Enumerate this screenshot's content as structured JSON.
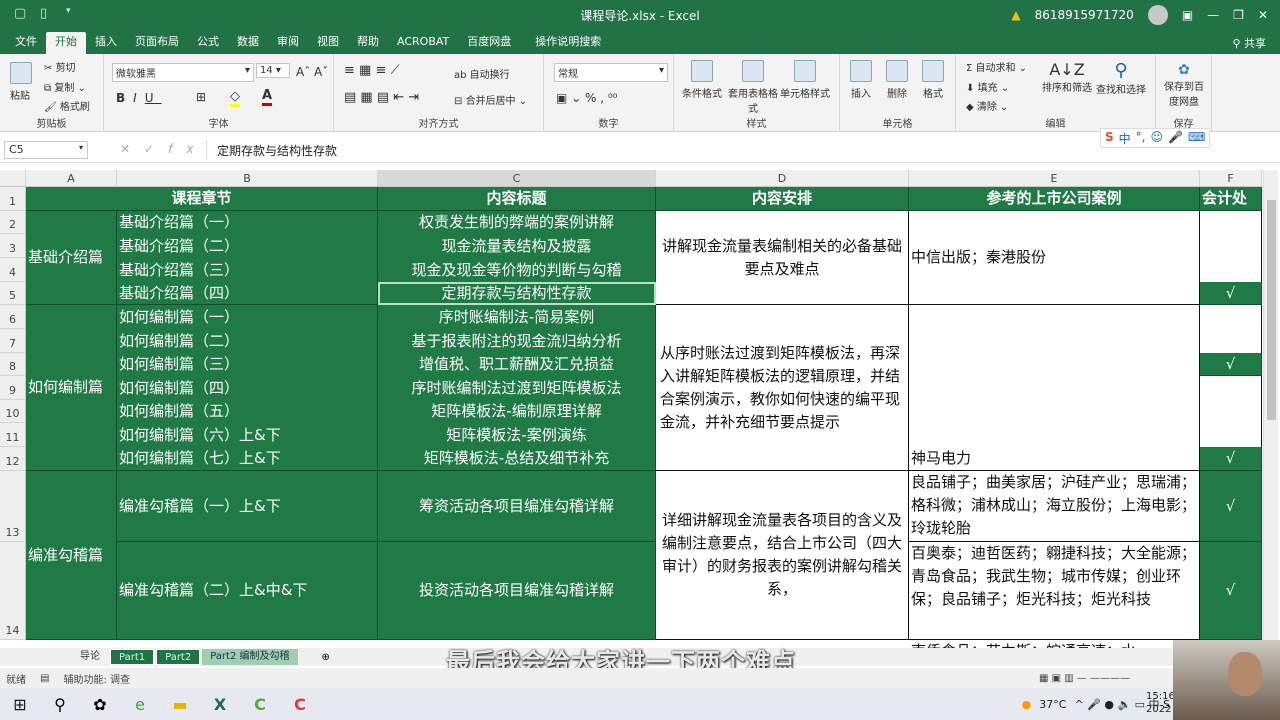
{
  "window": {
    "title": "课程导论.xlsx - Excel",
    "account": "8618915971720",
    "share": "共享"
  },
  "ribbon_tabs": [
    "文件",
    "开始",
    "插入",
    "页面布局",
    "公式",
    "数据",
    "审阅",
    "视图",
    "帮助",
    "ACROBAT",
    "百度网盘",
    "操作说明搜索"
  ],
  "ribbon": {
    "clipboard": {
      "paste": "粘贴",
      "cut": "剪切",
      "copy": "复制",
      "painter": "格式刷",
      "label": "剪贴板"
    },
    "font": {
      "name": "微软雅黑",
      "size": "14",
      "label": "字体"
    },
    "align": {
      "wrap": "自动换行",
      "merge": "合并后居中",
      "label": "对齐方式"
    },
    "number": {
      "format": "常规",
      "label": "数字"
    },
    "styles": {
      "cond": "条件格式",
      "table": "套用表格格式",
      "cell": "单元格样式",
      "label": "样式"
    },
    "cells": {
      "insert": "插入",
      "delete": "删除",
      "format": "格式",
      "label": "单元格"
    },
    "editing": {
      "autosum": "自动求和",
      "fill": "填充",
      "clear": "清除",
      "sort": "排序和筛选",
      "find": "查找和选择",
      "label": "编辑"
    },
    "save": {
      "baidu": "保存到百度网盘",
      "label": "保存"
    }
  },
  "formula_bar": {
    "name_box": "C5",
    "formula": "定期存款与结构性存款"
  },
  "columns": [
    "A",
    "B",
    "C",
    "D",
    "E",
    "F"
  ],
  "rows": [
    "1",
    "2",
    "3",
    "4",
    "5",
    "6",
    "7",
    "8",
    "9",
    "10",
    "11",
    "12",
    "13",
    "14"
  ],
  "cells": [
    {
      "col": "A",
      "row": 1,
      "span_cols": 2,
      "text": "课程章节",
      "style": "g h"
    },
    {
      "col": "C",
      "row": 1,
      "text": "内容标题",
      "style": "g h"
    },
    {
      "col": "D",
      "row": 1,
      "text": "内容安排",
      "style": "g h"
    },
    {
      "col": "E",
      "row": 1,
      "text": "参考的上市公司案例",
      "style": "g h"
    },
    {
      "col": "F",
      "row": 1,
      "text": "会计处",
      "style": "g h l"
    },
    {
      "col": "A",
      "row": 2,
      "span_rows": 4,
      "text": "基础介绍篇",
      "style": "g l"
    },
    {
      "col": "B",
      "row": 2,
      "text": "基础介绍篇（一）",
      "style": "g l nob"
    },
    {
      "col": "B",
      "row": 3,
      "text": "基础介绍篇（二）",
      "style": "g l nob"
    },
    {
      "col": "B",
      "row": 4,
      "text": "基础介绍篇（三）",
      "style": "g l nob"
    },
    {
      "col": "B",
      "row": 5,
      "text": "基础介绍篇（四）",
      "style": "g l"
    },
    {
      "col": "C",
      "row": 2,
      "text": "权责发生制的弊端的案例讲解",
      "style": "g c nob"
    },
    {
      "col": "C",
      "row": 3,
      "text": "现金流量表结构及披露",
      "style": "g c nob"
    },
    {
      "col": "C",
      "row": 4,
      "text": "现金及现金等价物的判断与勾稽",
      "style": "g c nob"
    },
    {
      "col": "C",
      "row": 5,
      "text": "定期存款与结构性存款",
      "style": "g c"
    },
    {
      "col": "D",
      "row": 2,
      "span_rows": 4,
      "text": "讲解现金流量表编制相关的必备基础要点及难点",
      "style": "w c"
    },
    {
      "col": "E",
      "row": 2,
      "span_rows": 4,
      "text": "中信出版；秦港股份",
      "style": "w l"
    },
    {
      "col": "F",
      "row": 2,
      "span_rows": 3,
      "text": "",
      "style": "w nob"
    },
    {
      "col": "F",
      "row": 5,
      "text": "√",
      "style": "g c"
    },
    {
      "col": "A",
      "row": 6,
      "span_rows": 7,
      "text": "如何编制篇",
      "style": "g l"
    },
    {
      "col": "B",
      "row": 6,
      "text": "如何编制篇（一）",
      "style": "g l nob"
    },
    {
      "col": "B",
      "row": 7,
      "text": "如何编制篇（二）",
      "style": "g l nob"
    },
    {
      "col": "B",
      "row": 8,
      "text": "如何编制篇（三）",
      "style": "g l nob"
    },
    {
      "col": "B",
      "row": 9,
      "text": "如何编制篇（四）",
      "style": "g l nob"
    },
    {
      "col": "B",
      "row": 10,
      "text": "如何编制篇（五）",
      "style": "g l nob"
    },
    {
      "col": "B",
      "row": 11,
      "text": "如何编制篇（六）上&下",
      "style": "g l nob"
    },
    {
      "col": "B",
      "row": 12,
      "text": "如何编制篇（七）上&下",
      "style": "g l"
    },
    {
      "col": "C",
      "row": 6,
      "text": "序时账编制法-简易案例",
      "style": "g c nob"
    },
    {
      "col": "C",
      "row": 7,
      "text": "基于报表附注的现金流归纳分析",
      "style": "g c nob"
    },
    {
      "col": "C",
      "row": 8,
      "text": "增值税、职工薪酬及汇兑损益",
      "style": "g c nob"
    },
    {
      "col": "C",
      "row": 9,
      "text": "序时账编制法过渡到矩阵模板法",
      "style": "g c nob"
    },
    {
      "col": "C",
      "row": 10,
      "text": "矩阵模板法-编制原理详解",
      "style": "g c nob"
    },
    {
      "col": "C",
      "row": 11,
      "text": "矩阵模板法-案例演练",
      "style": "g c nob"
    },
    {
      "col": "C",
      "row": 12,
      "text": "矩阵模板法-总结及细节补充",
      "style": "g c"
    },
    {
      "col": "D",
      "row": 6,
      "span_rows": 7,
      "text": "从序时账法过渡到矩阵模板法，再深入讲解矩阵模板法的逻辑原理，并结合案例演示，教你如何快速的编平现金流，并补充细节要点提示",
      "style": "w l"
    },
    {
      "col": "E",
      "row": 6,
      "span_rows": 7,
      "text": "神马电力",
      "style": "w l bot"
    },
    {
      "col": "F",
      "row": 6,
      "span_rows": 2,
      "text": "",
      "style": "w nob"
    },
    {
      "col": "F",
      "row": 8,
      "text": "√",
      "style": "g c"
    },
    {
      "col": "F",
      "row": 9,
      "span_rows": 3,
      "text": "",
      "style": "w nob"
    },
    {
      "col": "F",
      "row": 12,
      "text": "√",
      "style": "g c"
    },
    {
      "col": "A",
      "row": 13,
      "span_rows": 2,
      "text": "编准勾稽篇",
      "style": "g l"
    },
    {
      "col": "B",
      "row": 13,
      "text": "编准勾稽篇（一）上&下",
      "style": "g l"
    },
    {
      "col": "B",
      "row": 14,
      "text": "编准勾稽篇（二）上&中&下",
      "style": "g l"
    },
    {
      "col": "C",
      "row": 13,
      "text": "筹资活动各项目编准勾稽详解",
      "style": "g c"
    },
    {
      "col": "C",
      "row": 14,
      "text": "投资活动各项目编准勾稽详解",
      "style": "g c"
    },
    {
      "col": "D",
      "row": 13,
      "span_rows": 2,
      "text": "详细讲解现金流量表各项目的含义及编制注意要点，结合上市公司（四大审计）的财务报表的案例讲解勾稽关系，",
      "style": "w c"
    },
    {
      "col": "E",
      "row": 13,
      "text": "良品铺子；曲美家居；沪硅产业；思瑞浦；格科微；浦林成山；海立股份；上海电影；玲珑轮胎",
      "style": "w l top"
    },
    {
      "col": "E",
      "row": 14,
      "text": "百奥泰；迪哲医药；翱捷科技；大全能源；青岛食品；我武生物；城市传媒；创业环保；良品铺子；炬光科技；炬光科技",
      "style": "w l top"
    },
    {
      "col": "E",
      "row": 15,
      "text": "南侨食品；艾力斯；皖通高速；水",
      "style": "w l top"
    },
    {
      "col": "F",
      "row": 13,
      "text": "√",
      "style": "g c"
    },
    {
      "col": "F",
      "row": 14,
      "text": "√",
      "style": "g c"
    }
  ],
  "sheet_tabs": [
    "导论",
    "Part1",
    "Part2",
    "Part2 编制及勾稽"
  ],
  "active_sheet": "Part2 编制及勾稽",
  "status": {
    "ready": "就绪",
    "accessibility": "辅助功能: 调查"
  },
  "subtitle": "最后我会给大家讲一下两个难点",
  "taskbar": {
    "weather": "37°C",
    "clock": "15:16",
    "date": "2022"
  },
  "colors": {
    "excel_green": "#217346",
    "table_green": "#1f7a45"
  }
}
